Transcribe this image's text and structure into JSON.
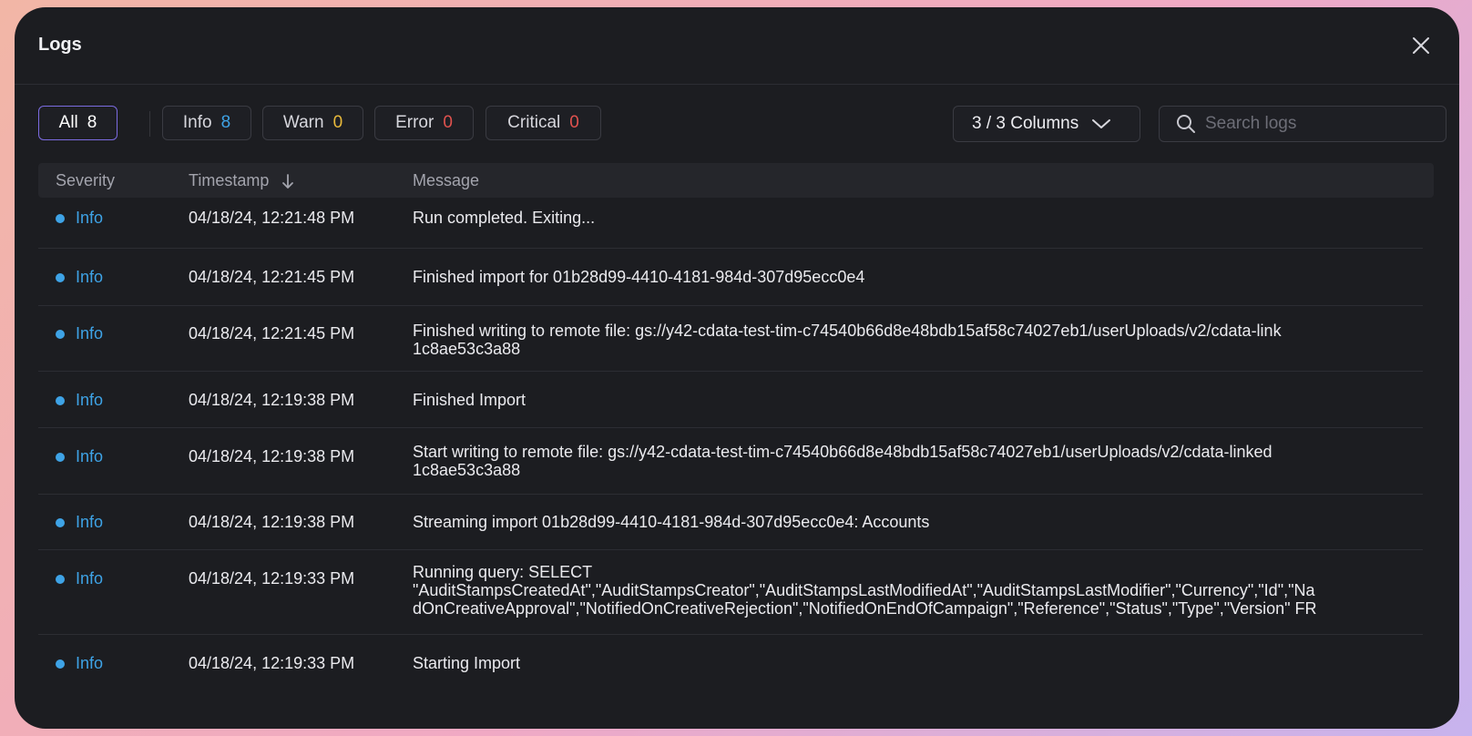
{
  "modal": {
    "title": "Logs"
  },
  "filters": [
    {
      "label": "All",
      "count": "8"
    },
    {
      "label": "Info",
      "count": "8"
    },
    {
      "label": "Warn",
      "count": "0"
    },
    {
      "label": "Error",
      "count": "0"
    },
    {
      "label": "Critical",
      "count": "0"
    }
  ],
  "columns_button": {
    "label": "3 / 3 Columns"
  },
  "search": {
    "placeholder": "Search logs"
  },
  "table": {
    "headers": {
      "severity": "Severity",
      "timestamp": "Timestamp",
      "message": "Message"
    },
    "rows": [
      {
        "severity": "Info",
        "timestamp": "04/18/24, 12:21:48 PM",
        "message": "Run completed. Exiting..."
      },
      {
        "severity": "Info",
        "timestamp": "04/18/24, 12:21:45 PM",
        "message": "Finished import for 01b28d99-4410-4181-984d-307d95ecc0e4"
      },
      {
        "severity": "Info",
        "timestamp": "04/18/24, 12:21:45 PM",
        "message": "Finished writing to remote file: gs://y42-cdata-test-tim-c74540b66d8e48bdb15af58c74027eb1/userUploads/v2/cdata-link\n1c8ae53c3a88"
      },
      {
        "severity": "Info",
        "timestamp": "04/18/24, 12:19:38 PM",
        "message": "Finished Import"
      },
      {
        "severity": "Info",
        "timestamp": "04/18/24, 12:19:38 PM",
        "message": "Start writing to remote file: gs://y42-cdata-test-tim-c74540b66d8e48bdb15af58c74027eb1/userUploads/v2/cdata-linked\n1c8ae53c3a88"
      },
      {
        "severity": "Info",
        "timestamp": "04/18/24, 12:19:38 PM",
        "message": "Streaming import 01b28d99-4410-4181-984d-307d95ecc0e4: Accounts"
      },
      {
        "severity": "Info",
        "timestamp": "04/18/24, 12:19:33 PM",
        "message": "Running query: SELECT\n\"AuditStampsCreatedAt\",\"AuditStampsCreator\",\"AuditStampsLastModifiedAt\",\"AuditStampsLastModifier\",\"Currency\",\"Id\",\"Na\ndOnCreativeApproval\",\"NotifiedOnCreativeRejection\",\"NotifiedOnEndOfCampaign\",\"Reference\",\"Status\",\"Type\",\"Version\" FR"
      },
      {
        "severity": "Info",
        "timestamp": "04/18/24, 12:19:33 PM",
        "message": "Starting Import"
      }
    ]
  },
  "colors": {
    "info": "#3ea3e6",
    "warn": "#e8b93b",
    "error": "#e0524e",
    "accent": "#7b6be0"
  }
}
